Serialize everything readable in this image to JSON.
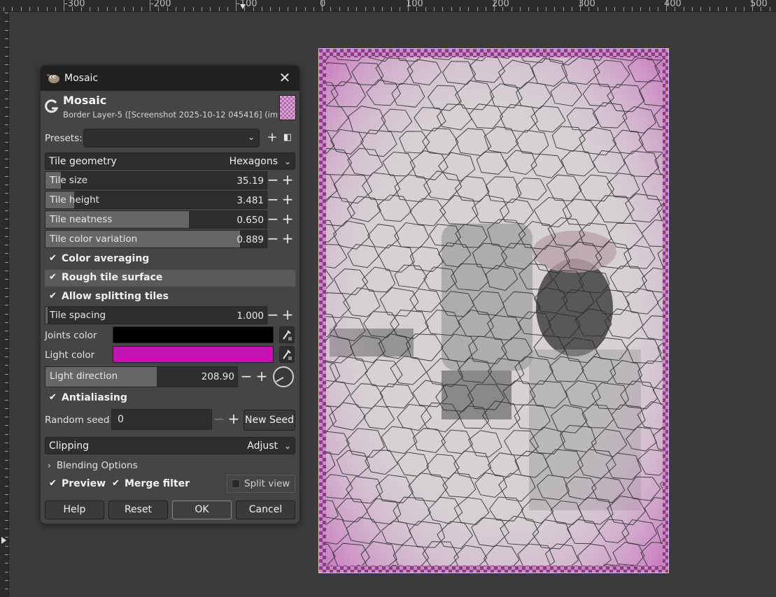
{
  "ruler": {
    "labels": [
      "-300",
      "-200",
      "-100",
      "0",
      "100",
      "200",
      "300",
      "400",
      "500"
    ]
  },
  "dialog": {
    "window_title": "Mosaic",
    "header_title": "Mosaic",
    "header_subtitle": "Border Layer-5 ([Screenshot 2025-10-12 045416] (im...",
    "presets_label": "Presets:",
    "presets_value": "",
    "tile_geometry": {
      "label": "Tile geometry",
      "value": "Hexagons"
    },
    "tile_size": {
      "label": "Tile size",
      "value": "35.19",
      "fill": 0.07
    },
    "tile_height": {
      "label": "Tile height",
      "value": "3.481",
      "fill": 0.13
    },
    "tile_neatness": {
      "label": "Tile neatness",
      "value": "0.650",
      "fill": 0.65
    },
    "tile_color_variation": {
      "label": "Tile color variation",
      "value": "0.889",
      "fill": 0.88
    },
    "color_averaging": {
      "label": "Color averaging",
      "checked": true
    },
    "rough_tile_surface": {
      "label": "Rough tile surface",
      "checked": true
    },
    "allow_splitting_tiles": {
      "label": "Allow splitting tiles",
      "checked": true
    },
    "tile_spacing": {
      "label": "Tile spacing",
      "value": "1.000",
      "fill": 0.01
    },
    "joints_color": {
      "label": "Joints color",
      "color": "#000000"
    },
    "light_color": {
      "label": "Light color",
      "color": "#c412b3"
    },
    "light_direction": {
      "label": "Light direction",
      "value": "208.90",
      "fill": 0.58
    },
    "antialiasing": {
      "label": "Antialiasing",
      "checked": true
    },
    "random_seed": {
      "label": "Random seed",
      "value": "0",
      "new_seed": "New Seed"
    },
    "clipping": {
      "label": "Clipping",
      "value": "Adjust"
    },
    "blending_options": "Blending Options",
    "preview": {
      "label": "Preview",
      "checked": true
    },
    "merge_filter": {
      "label": "Merge filter",
      "checked": true
    },
    "split_view": {
      "label": "Split view",
      "checked": false
    },
    "buttons": {
      "help": "Help",
      "reset": "Reset",
      "ok": "OK",
      "cancel": "Cancel"
    }
  },
  "colors": {
    "canvas_bg": "#3b3b3b",
    "dialog_bg": "#454545",
    "accent_magenta": "#c412b3"
  }
}
